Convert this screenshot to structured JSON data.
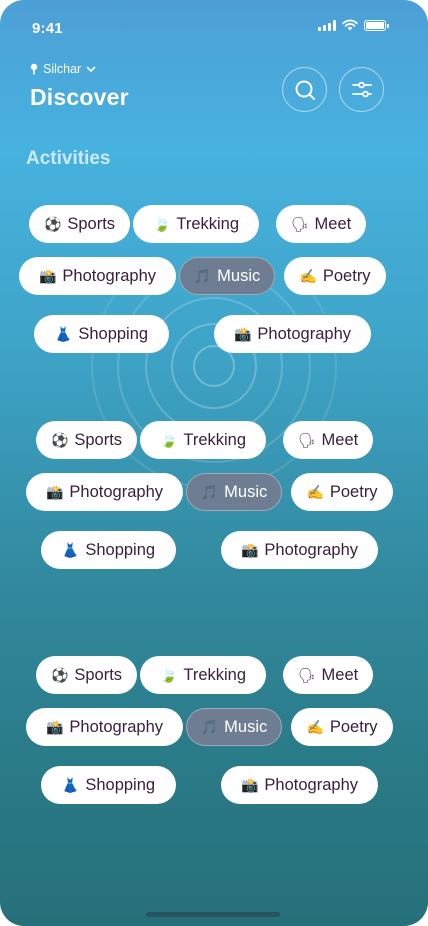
{
  "status_bar": {
    "time": "9:41"
  },
  "header": {
    "location": "Silchar",
    "title": "Discover",
    "search_icon": "search-icon",
    "filter_icon": "sliders-icon"
  },
  "section": {
    "title": "Activities"
  },
  "chips": [
    {
      "label": "Sports",
      "icon": "⚽"
    },
    {
      "label": "Trekking",
      "icon": "🍃"
    },
    {
      "label": "Meet",
      "icon": "🗣"
    },
    {
      "label": "Photography",
      "icon": "📸"
    },
    {
      "label": "Music",
      "icon": "🎵",
      "selected": true
    },
    {
      "label": "Poetry",
      "icon": "✍️"
    },
    {
      "label": "Shopping",
      "icon": "👗"
    },
    {
      "label": "Photography",
      "icon": "📸"
    }
  ],
  "colors": {
    "gradient_top": "#47b2df",
    "gradient_bottom": "#26707a",
    "chip_bg": "#ffffff",
    "chip_selected_bg": "#6e7d92",
    "chip_text": "#3a1e3e"
  }
}
